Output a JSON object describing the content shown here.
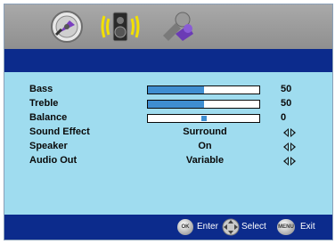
{
  "tabs": [
    {
      "name": "Picture",
      "icon": "picture-icon"
    },
    {
      "name": "Audio",
      "icon": "speaker-icon",
      "selected": true
    },
    {
      "name": "Setup",
      "icon": "tools-icon"
    }
  ],
  "audio_menu": {
    "bass": {
      "label": "Bass",
      "value": "50",
      "level": 0.5
    },
    "treble": {
      "label": "Treble",
      "value": "50",
      "level": 0.5
    },
    "balance": {
      "label": "Balance",
      "value": "0",
      "level": 0.0
    },
    "sound_effect": {
      "label": "Sound Effect",
      "value": "Surround"
    },
    "speaker": {
      "label": "Speaker",
      "value": "On"
    },
    "audio_out": {
      "label": "Audio Out",
      "value": "Variable"
    }
  },
  "footer": {
    "ok_button": "OK",
    "enter_label": "Enter",
    "select_label": "Select",
    "menu_button": "MENU",
    "exit_label": "Exit"
  },
  "colors": {
    "panel": "#9fdcef",
    "bar": "#0c2b8c",
    "slider_fill": "#3f8ed1",
    "tabbar": "#a0a0a0"
  }
}
